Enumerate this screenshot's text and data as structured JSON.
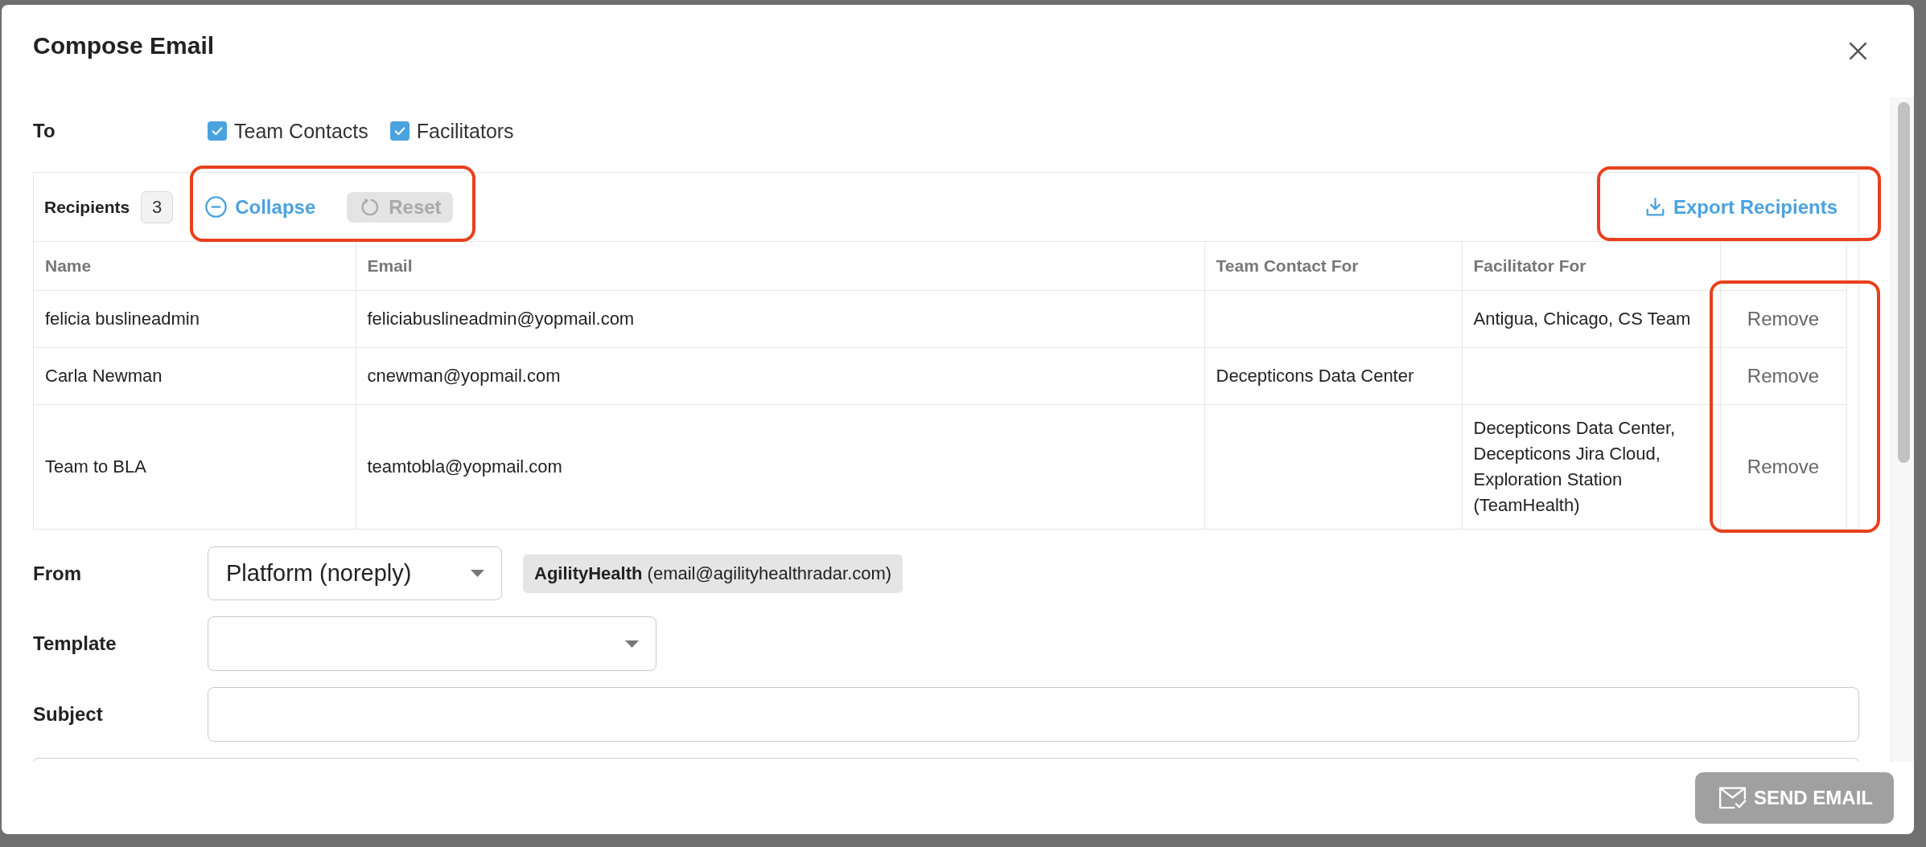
{
  "dialog": {
    "title": "Compose Email"
  },
  "to": {
    "label": "To",
    "options": [
      {
        "label": "Team Contacts",
        "checked": true
      },
      {
        "label": "Facilitators",
        "checked": true
      }
    ]
  },
  "recipients": {
    "label": "Recipients",
    "count": "3",
    "collapse": {
      "label": "Collapse"
    },
    "reset": {
      "label": "Reset",
      "disabled": true
    },
    "actions_highlighted": true,
    "export": {
      "label": "Export Recipients",
      "highlighted": true
    }
  },
  "table": {
    "columns": [
      "Name",
      "Email",
      "Team Contact For",
      "Facilitator For"
    ],
    "action_column_highlighted": true,
    "rows": [
      {
        "name": "felicia buslineadmin",
        "email": "feliciabuslineadmin@yopmail.com",
        "facilitator_for": "Antigua, Chicago, CS Team",
        "action": "Remove"
      },
      {
        "name": "Carla Newman",
        "email": "cnewman@yopmail.com",
        "team_contact_for": "Decepticons Data Center",
        "action": "Remove"
      },
      {
        "name": "Team to BLA",
        "email": "teamtobla@yopmail.com",
        "facilitator_for": "Decepticons Data Center, Decepticons Jira Cloud, Exploration Station (TeamHealth)",
        "action": "Remove"
      }
    ]
  },
  "from": {
    "label": "From",
    "value": "Platform (noreply)",
    "sender": "**AgilityHealth** (email@agilityhealthradar.com)"
  },
  "template": {
    "label": "Template"
  },
  "subject": {
    "label": "Subject"
  },
  "send_button": {
    "label": "SEND EMAIL",
    "disabled": true
  }
}
